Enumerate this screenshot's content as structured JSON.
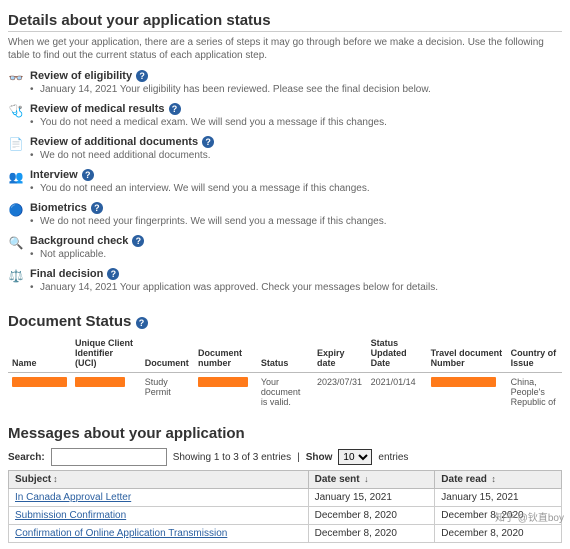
{
  "details": {
    "title": "Details about your application status",
    "intro": "When we get your application, there are a series of steps it may go through before we make a decision. Use the following table to find out the current status of each application step."
  },
  "steps": [
    {
      "icon": "👓",
      "name": "review-eligibility",
      "title": "Review of eligibility",
      "desc": "January 14, 2021 Your eligibility has been reviewed. Please see the final decision below."
    },
    {
      "icon": "🩺",
      "name": "review-medical",
      "title": "Review of medical results",
      "desc": "You do not need a medical exam. We will send you a message if this changes."
    },
    {
      "icon": "📄",
      "name": "review-additional",
      "title": "Review of additional documents",
      "desc": "We do not need additional documents."
    },
    {
      "icon": "👥",
      "name": "interview",
      "title": "Interview",
      "desc": "You do not need an interview. We will send you a message if this changes."
    },
    {
      "icon": "🔵",
      "name": "biometrics",
      "title": "Biometrics",
      "desc": "We do not need your fingerprints. We will send you a message if this changes."
    },
    {
      "icon": "🔍",
      "name": "background-check",
      "title": "Background check",
      "desc": "Not applicable."
    },
    {
      "icon": "⚖️",
      "name": "final-decision",
      "title": "Final decision",
      "desc": "January 14, 2021 Your application was approved. Check your messages below for details."
    }
  ],
  "docStatus": {
    "title": "Document Status",
    "headers": {
      "name": "Name",
      "uci": "Unique Client Identifier (UCI)",
      "document": "Document",
      "docnum": "Document number",
      "status": "Status",
      "expiry": "Expiry date",
      "updated": "Status Updated Date",
      "travel": "Travel document Number",
      "country": "Country of Issue"
    },
    "row": {
      "document": "Study Permit",
      "status": "Your document is valid.",
      "expiry": "2023/07/31",
      "updated": "2021/01/14",
      "country": "China, People's Republic of"
    }
  },
  "messages": {
    "title": "Messages about your application",
    "searchLabel": "Search:",
    "showing": "Showing 1 to 3 of 3 entries",
    "showLabel": "Show",
    "showValue": "10",
    "entriesLabel": "entries",
    "headers": {
      "subject": "Subject",
      "sent": "Date sent",
      "read": "Date read"
    },
    "rows": [
      {
        "subject": "In Canada Approval Letter",
        "sent": "January 15, 2021",
        "read": "January 15, 2021"
      },
      {
        "subject": "Submission Confirmation",
        "sent": "December 8, 2020",
        "read": "December 8, 2020"
      },
      {
        "subject": "Confirmation of Online Application Transmission",
        "sent": "December 8, 2020",
        "read": "December 8, 2020"
      }
    ]
  },
  "watermark": "知乎 @钬直boy"
}
